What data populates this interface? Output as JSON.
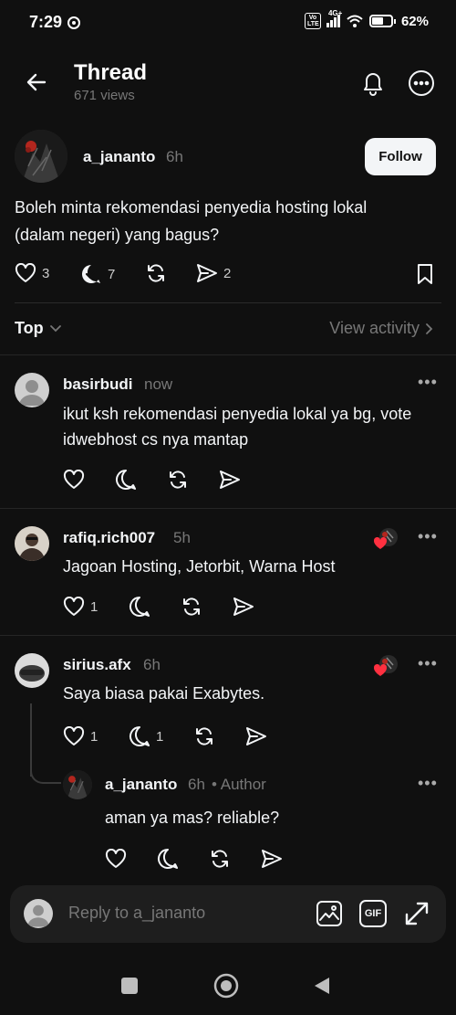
{
  "status": {
    "time": "7:29",
    "network": "4G+",
    "volte": "Vo LTE",
    "battery": "62%"
  },
  "header": {
    "title": "Thread",
    "views": "671 views"
  },
  "post": {
    "username": "a_jananto",
    "time": "6h",
    "follow_label": "Follow",
    "text": "Boleh minta rekomendasi penyedia hosting lokal (dalam negeri) yang bagus?",
    "likes": "3",
    "replies": "7",
    "shares": "2"
  },
  "sort": {
    "label": "Top",
    "view_activity": "View activity"
  },
  "replies": [
    {
      "username": "basirbudi",
      "time": "now",
      "text": "ikut ksh rekomendasi penyedia lokal ya bg, vote idwebhost cs nya mantap"
    },
    {
      "username": "rafiq.rich007",
      "time": "5h",
      "text": "Jagoan Hosting, Jetorbit, Warna Host",
      "likes": "1"
    },
    {
      "username": "sirius.afx",
      "time": "6h",
      "text": "Saya biasa pakai Exabytes.",
      "likes": "1",
      "replies": "1"
    },
    {
      "username": "a_jananto",
      "time": "6h",
      "author_tag": "• Author",
      "text": "aman ya mas? reliable?"
    }
  ],
  "composer": {
    "placeholder": "Reply to a_jananto",
    "gif_label": "GIF"
  },
  "icons": [
    "back-arrow-icon",
    "bell-icon",
    "more-icon",
    "heart-icon",
    "reply-icon",
    "repost-icon",
    "share-icon",
    "bookmark-icon",
    "image-icon",
    "gif-icon",
    "expand-icon"
  ]
}
